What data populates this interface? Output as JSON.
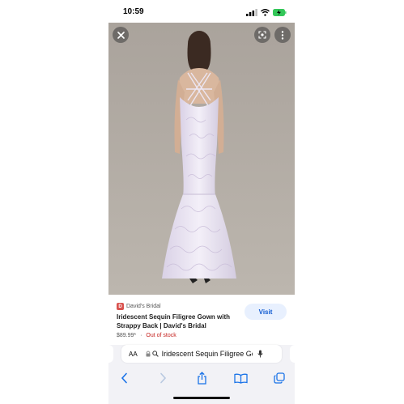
{
  "status_bar": {
    "time": "10:59"
  },
  "image_viewer": {
    "close_icon": "close-icon",
    "lens_icon": "lens-icon",
    "more_icon": "more-vertical-icon"
  },
  "result": {
    "favicon_letter": "D",
    "source": "David's Bridal",
    "title": "Iridescent Sequin Filigree Gown with Strappy Back | David's Bridal",
    "price": "$89.99*",
    "separator": "·",
    "stock": "Out of stock",
    "visit_label": "Visit"
  },
  "address_bar": {
    "aa_label": "AA",
    "url_text": "Iridescent Sequin Filigree Gown"
  },
  "colors": {
    "accent": "#0b57d0",
    "visit_bg": "#e8f0fe",
    "stock": "#c5221f",
    "toolbar_icon": "#1a73e8"
  }
}
